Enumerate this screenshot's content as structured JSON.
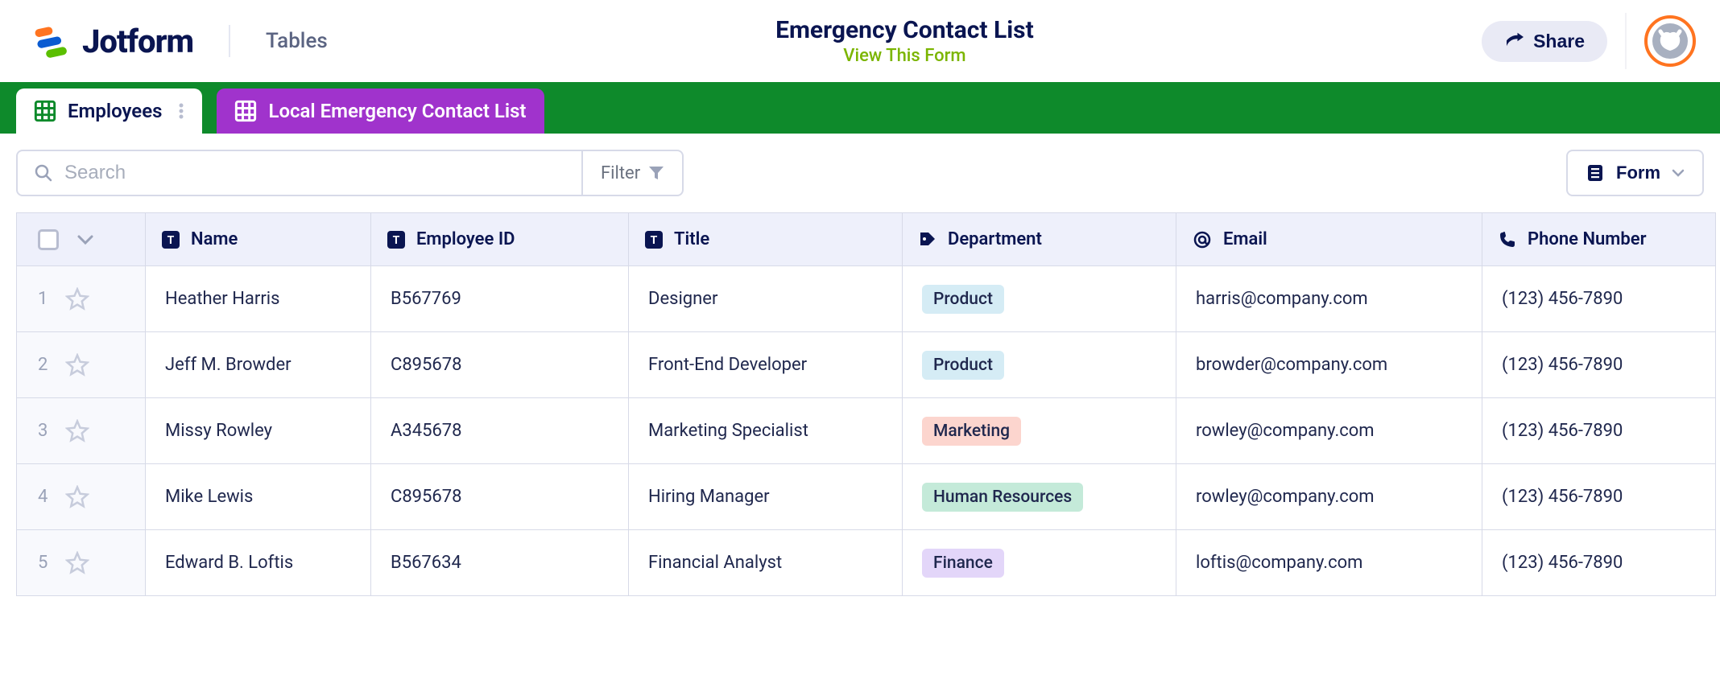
{
  "header": {
    "brand": "Jotform",
    "section": "Tables",
    "title": "Emergency Contact List",
    "view_form": "View This Form",
    "share": "Share"
  },
  "tabs": [
    {
      "label": "Employees",
      "active": true
    },
    {
      "label": "Local Emergency Contact List",
      "active": false
    }
  ],
  "toolbar": {
    "search_placeholder": "Search",
    "filter_label": "Filter",
    "form_label": "Form"
  },
  "columns": {
    "name": "Name",
    "employee_id": "Employee ID",
    "title": "Title",
    "department": "Department",
    "email": "Email",
    "phone": "Phone Number"
  },
  "dept_colors": {
    "Product": "#d5ecf5",
    "Marketing": "#fcd5ce",
    "Human Resources": "#c4ead9",
    "Finance": "#e3d6f9"
  },
  "rows": [
    {
      "idx": "1",
      "name": "Heather Harris",
      "employee_id": "B567769",
      "title": "Designer",
      "department": "Product",
      "email": "harris@company.com",
      "phone": "(123) 456-7890"
    },
    {
      "idx": "2",
      "name": "Jeff M. Browder",
      "employee_id": "C895678",
      "title": "Front-End Developer",
      "department": "Product",
      "email": "browder@company.com",
      "phone": "(123) 456-7890"
    },
    {
      "idx": "3",
      "name": "Missy Rowley",
      "employee_id": "A345678",
      "title": "Marketing Specialist",
      "department": "Marketing",
      "email": "rowley@company.com",
      "phone": "(123) 456-7890"
    },
    {
      "idx": "4",
      "name": "Mike Lewis",
      "employee_id": "C895678",
      "title": "Hiring Manager",
      "department": "Human Resources",
      "email": "rowley@company.com",
      "phone": "(123) 456-7890"
    },
    {
      "idx": "5",
      "name": "Edward B. Loftis",
      "employee_id": "B567634",
      "title": "Financial Analyst",
      "department": "Finance",
      "email": "loftis@company.com",
      "phone": "(123) 456-7890"
    }
  ]
}
